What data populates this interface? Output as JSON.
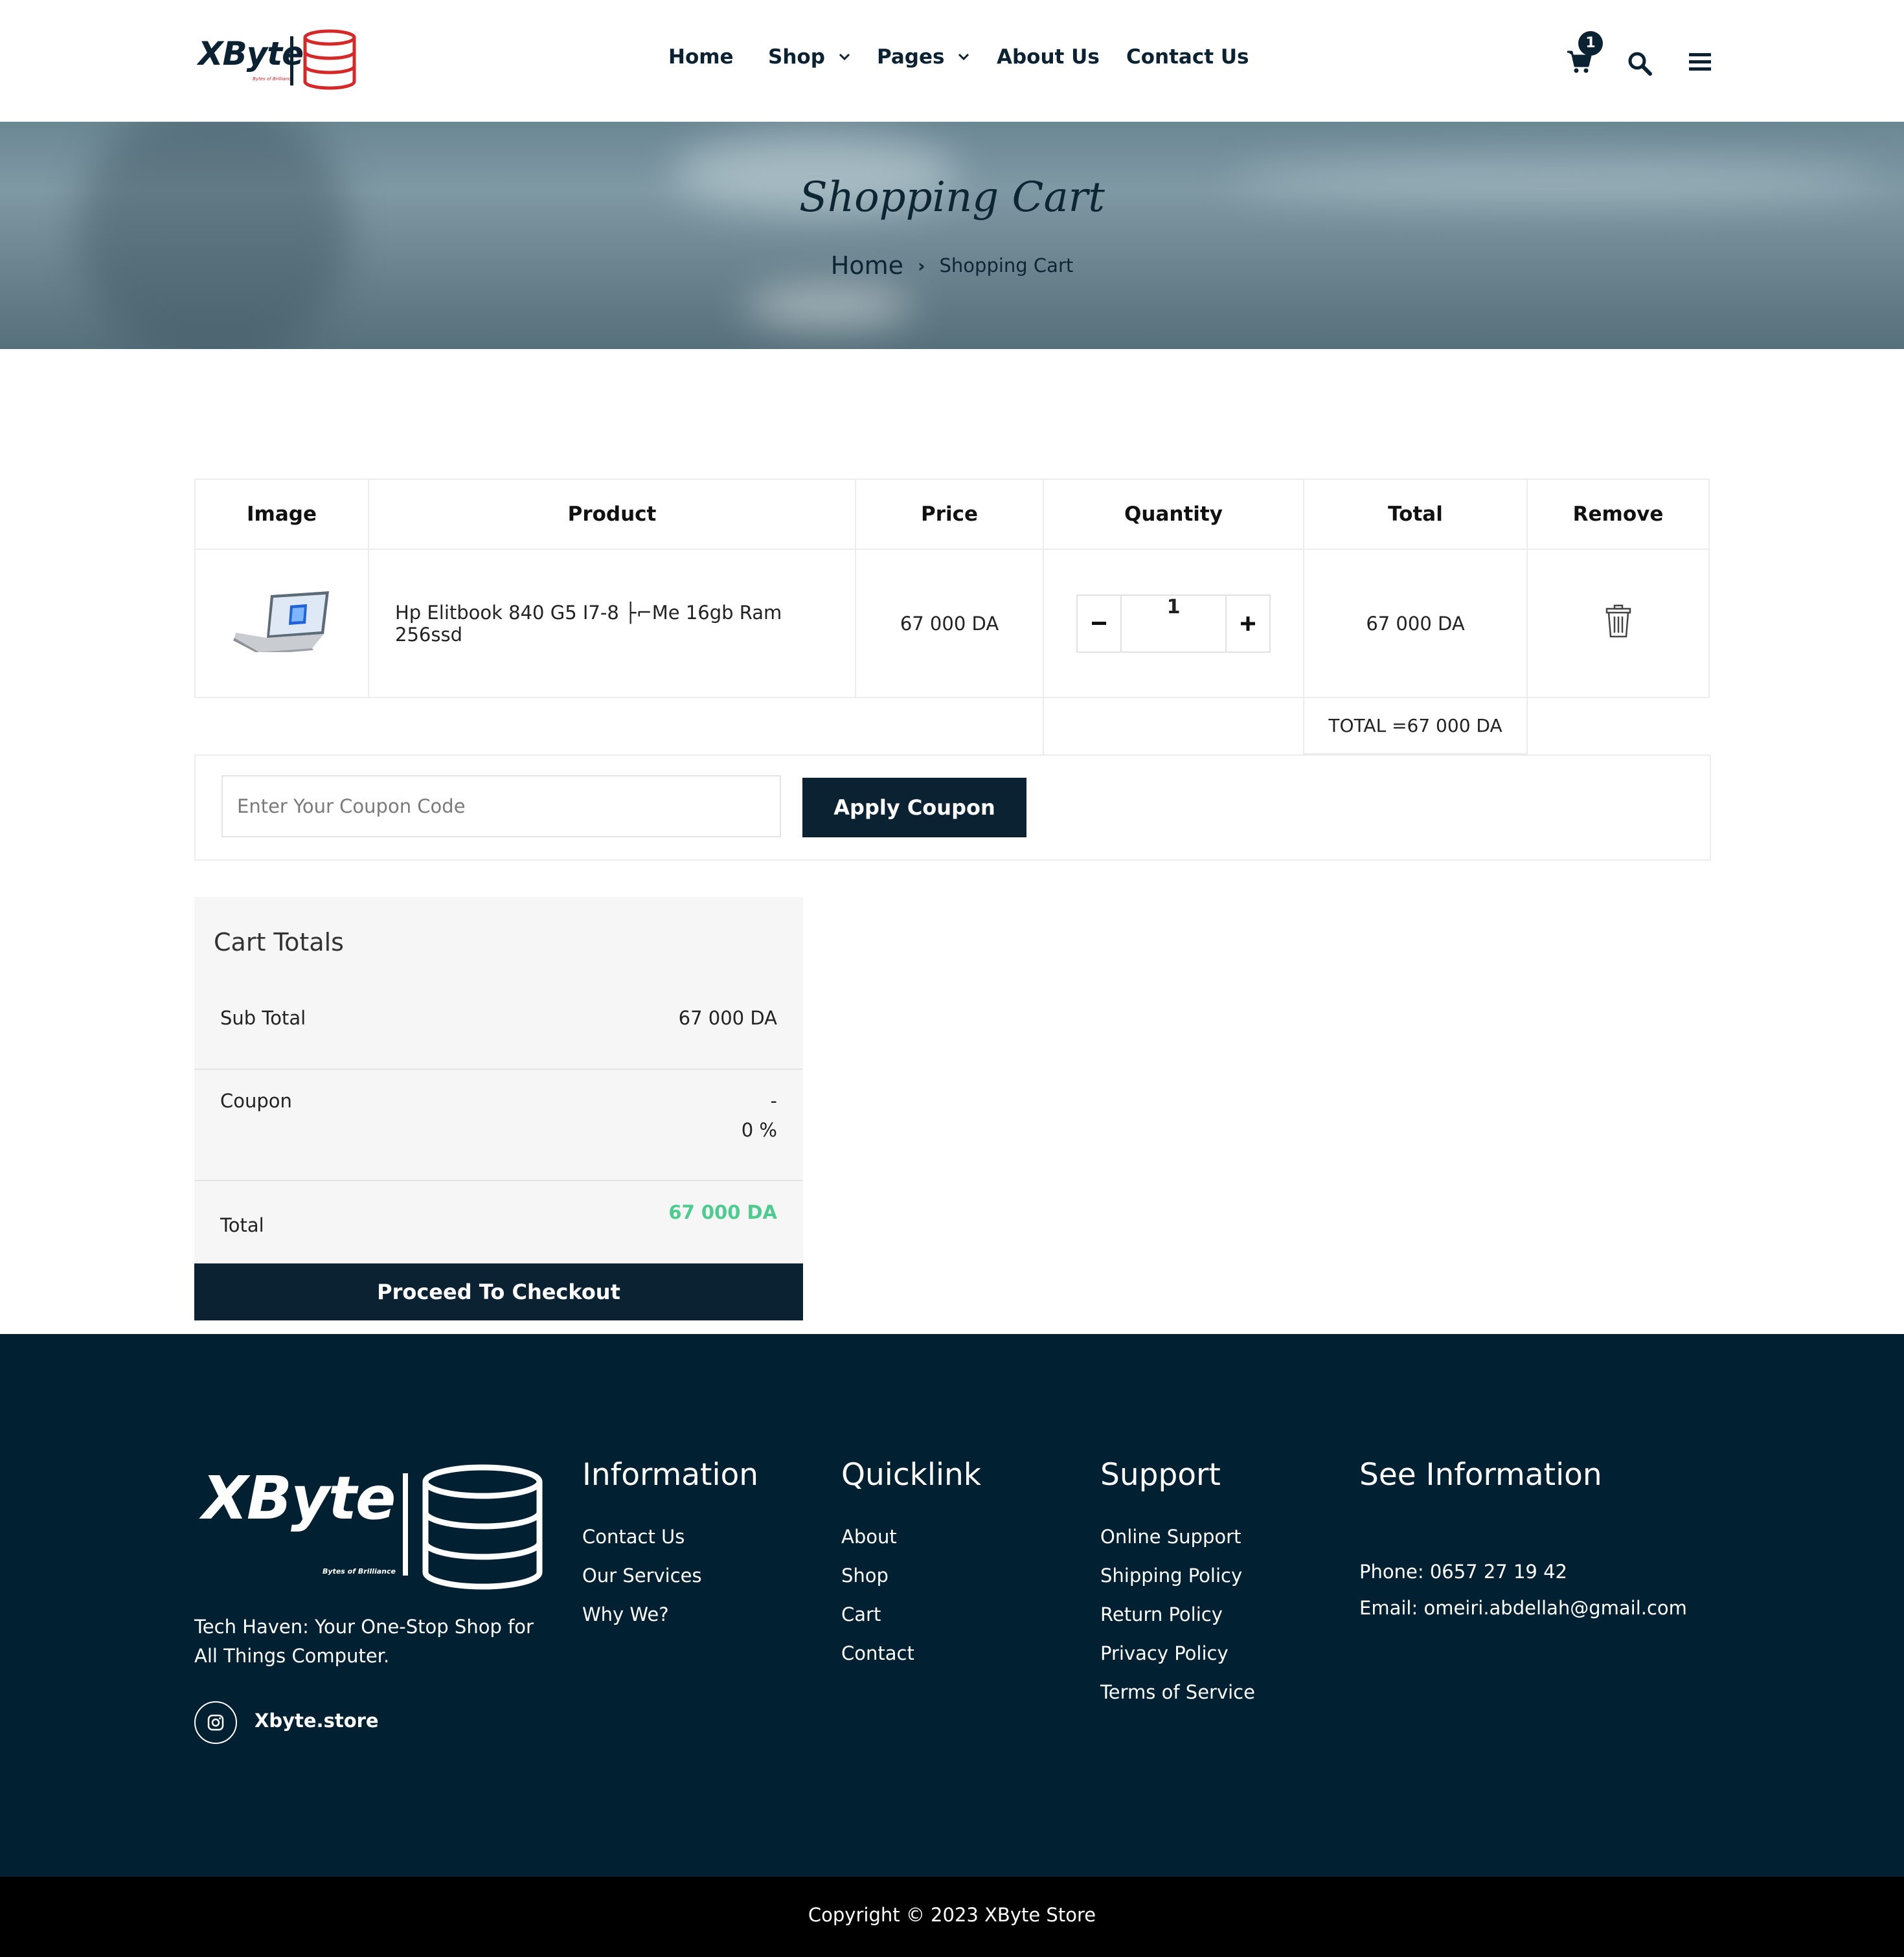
{
  "brand": {
    "name": "XByte",
    "tagline": "Bytes of Brilliance",
    "accent_color": "#d62828",
    "dark_color": "#0b2233"
  },
  "nav": {
    "items": [
      {
        "label": "Home"
      },
      {
        "label": "Shop",
        "has_dropdown": true
      },
      {
        "label": "Pages",
        "has_dropdown": true
      },
      {
        "label": "About Us"
      },
      {
        "label": "Contact Us"
      }
    ],
    "cart_count": "1",
    "icons": [
      "cart-icon",
      "search-icon",
      "menu-icon"
    ]
  },
  "hero": {
    "title": "Shopping Cart",
    "breadcrumb": {
      "home": "Home",
      "separator": "›",
      "current": "Shopping Cart"
    }
  },
  "cart": {
    "headers": [
      "Image",
      "Product",
      "Price",
      "Quantity",
      "Total",
      "Remove"
    ],
    "items": [
      {
        "image_icon": "laptop-icon",
        "product": "Hp Elitbook 840 G5 I7-8 ├⌐Me 16gb Ram 256ssd",
        "price": "67 000 DA",
        "quantity": "1",
        "total": "67 000 DA",
        "remove_icon": "trash-icon"
      }
    ],
    "grand_total": "TOTAL =67 000 DA"
  },
  "coupon": {
    "placeholder": "Enter Your Coupon Code",
    "value": "",
    "button": "Apply Coupon"
  },
  "totals": {
    "title": "Cart Totals",
    "subtotal_label": "Sub Total",
    "subtotal_value": "67 000 DA",
    "coupon_label": "Coupon",
    "coupon_value": "-",
    "coupon_percent": "0 %",
    "total_label": "Total",
    "total_value": "67 000 DA",
    "total_color": "#4ecb8f",
    "checkout_button": "Proceed To Checkout"
  },
  "footer": {
    "logo_word": "XByte",
    "logo_tagline": "Bytes of Brilliance",
    "description": "Tech Haven: Your One-Stop Shop for All Things Computer.",
    "social": {
      "icon": "instagram-icon",
      "label": "Xbyte.store"
    },
    "columns": [
      {
        "title": "Information",
        "links": [
          "Contact Us",
          "Our Services",
          "Why We?"
        ]
      },
      {
        "title": "Quicklink",
        "links": [
          "About",
          "Shop",
          "Cart",
          "Contact"
        ]
      },
      {
        "title": "Support",
        "links": [
          "Online Support",
          "Shipping Policy",
          "Return Policy",
          "Privacy Policy",
          "Terms of Service"
        ]
      },
      {
        "title": "See Information",
        "links": [
          "Phone: 0657 27 19 42",
          "Email: omeiri.abdellah@gmail.com"
        ]
      }
    ],
    "background": "#012133",
    "copyright": "Copyright © 2023 XByte Store"
  }
}
